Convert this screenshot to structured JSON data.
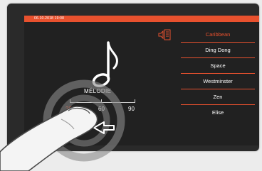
{
  "status": {
    "datetime": "06.10.2018   19:08"
  },
  "melody": {
    "label": "MÉLODIE"
  },
  "volume": {
    "options": [
      "30",
      "60",
      "90"
    ],
    "selected": "30"
  },
  "menu": {
    "icon": "speaker-book-icon",
    "items": [
      {
        "label": "Caribbean",
        "selected": true
      },
      {
        "label": "Ding Dong",
        "selected": false
      },
      {
        "label": "Space",
        "selected": false
      },
      {
        "label": "Westminster",
        "selected": false
      },
      {
        "label": "Zen",
        "selected": false
      },
      {
        "label": "Elise",
        "selected": false
      }
    ]
  },
  "colors": {
    "accent": "#e8512e",
    "screen": "#212121",
    "frame": "#2a2a2a"
  }
}
